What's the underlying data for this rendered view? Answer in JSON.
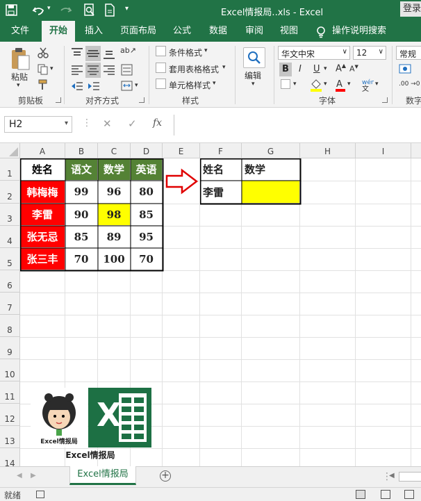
{
  "window": {
    "title": "Excel情报局..xls  -  Excel",
    "login_label": "登录"
  },
  "tabs": [
    "文件",
    "开始",
    "插入",
    "页面布局",
    "公式",
    "数据",
    "审阅",
    "视图"
  ],
  "tell_me": "操作说明搜索",
  "ribbon": {
    "clipboard": {
      "paste": "粘贴",
      "label": "剪贴板"
    },
    "alignment": {
      "label": "对齐方式"
    },
    "styles": {
      "conditional": "条件格式",
      "table": "套用表格格式",
      "cell": "单元格样式",
      "label": "样式"
    },
    "editing": {
      "label": "编辑"
    },
    "font": {
      "name": "华文中宋",
      "size": "12",
      "label": "字体",
      "bold": "B",
      "italic": "I",
      "underline": "U"
    },
    "number": {
      "format": "常规",
      "label": "数字"
    }
  },
  "formula_bar": {
    "name_box": "H2",
    "fx": "fx",
    "content": ""
  },
  "columns": [
    "A",
    "B",
    "C",
    "D",
    "E",
    "F",
    "G",
    "H",
    "I"
  ],
  "rows": [
    "1",
    "2",
    "3",
    "4",
    "5",
    "6",
    "7",
    "8",
    "9",
    "10",
    "11",
    "12",
    "13",
    "14"
  ],
  "cells": {
    "A1": "姓名",
    "B1": "语文",
    "C1": "数学",
    "D1": "英语",
    "A2": "韩梅梅",
    "B2": "99",
    "C2": "96",
    "D2": "80",
    "A3": "李雷",
    "B3": "90",
    "C3": "98",
    "D3": "85",
    "A4": "张无忌",
    "B4": "85",
    "C4": "89",
    "D4": "95",
    "A5": "张三丰",
    "B5": "70",
    "C5": "100",
    "D5": "70",
    "F1": "姓名",
    "G1": "数学",
    "F2": "李雷",
    "G2": ""
  },
  "logo": {
    "badge": "Excel情报局",
    "caption": "Excel情报局",
    "x_letter": "X"
  },
  "sheet_tab": "Excel情报局",
  "status": {
    "ready": "就绪"
  },
  "colors": {
    "excel_green": "#217346",
    "red": "#ff0000",
    "green_header": "#548235",
    "yellow": "#ffff00"
  }
}
